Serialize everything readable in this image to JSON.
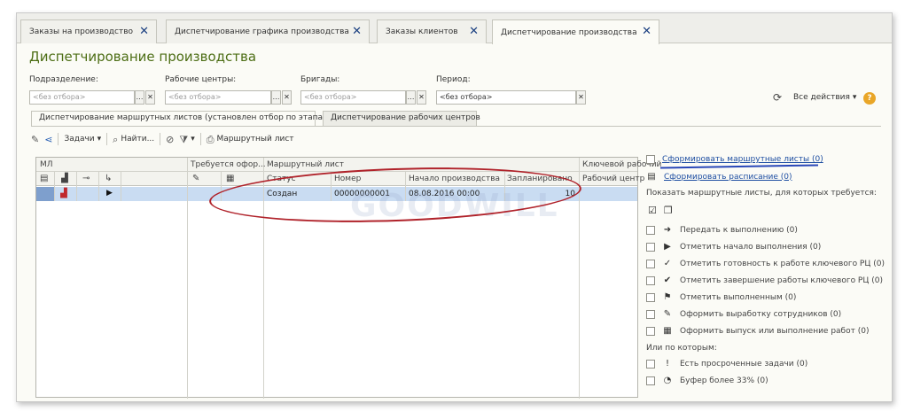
{
  "tabs": [
    {
      "label": "Заказы на производство"
    },
    {
      "label": "Диспетчирование графика производства"
    },
    {
      "label": "Заказы клиентов"
    },
    {
      "label": "Диспетчирование производства"
    }
  ],
  "page_title": "Диспетчирование производства",
  "filters": {
    "division_label": "Подразделение:",
    "division_value": "<без отбора>",
    "workcenters_label": "Рабочие центры:",
    "workcenters_value": "<без отбора>",
    "brigades_label": "Бригады:",
    "brigades_value": "<без отбора>",
    "period_label": "Период:",
    "period_value": "<без отбора>"
  },
  "all_actions": "Все действия",
  "section_tabs": [
    {
      "label": "Диспетчирование маршрутных листов (установлен отбор по этапам)"
    },
    {
      "label": "Диспетчирование рабочих центров"
    }
  ],
  "toolbar": {
    "tasks": "Задачи",
    "find": "Найти...",
    "route_sheet": "Маршрутный лист"
  },
  "grid": {
    "group_ml": "МЛ",
    "group_required": "Требуется офор...",
    "group_route_sheet": "Маршрутный лист",
    "group_key_wc": "Ключевой рабочий",
    "col_status": "Статус",
    "col_number": "Номер",
    "col_start": "Начало производства",
    "col_planned": "Запланировано",
    "col_workcenter": "Рабочий центр",
    "rows": [
      {
        "status": "Создан",
        "number": "00000000001",
        "start": "08.08.2016 00:00",
        "planned": "10",
        "workcenter": ""
      }
    ]
  },
  "right_panel": {
    "link_generate_sheets": "Сформировать маршрутные листы (0)",
    "link_generate_schedule": "Сформировать расписание (0)",
    "show_label": "Показать маршрутные листы, для которых требуется:",
    "items": [
      {
        "icon": "arrow-right-icon",
        "label": "Передать к выполнению (0)"
      },
      {
        "icon": "play-icon",
        "label": "Отметить начало выполнения (0)"
      },
      {
        "icon": "check-outline-icon",
        "label": "Отметить готовность к работе ключевого РЦ (0)"
      },
      {
        "icon": "check-icon",
        "label": "Отметить завершение работы ключевого РЦ (0)"
      },
      {
        "icon": "finish-flag-icon",
        "label": "Отметить выполненным (0)"
      },
      {
        "icon": "wrench-icon",
        "label": "Оформить выработку сотрудников (0)"
      },
      {
        "icon": "grid-icon",
        "label": "Оформить выпуск или выполнение работ (0)"
      }
    ],
    "or_label": "Или по которым:",
    "extra_items": [
      {
        "icon": "exclamation-icon",
        "label": "Есть просроченные задачи (0)"
      },
      {
        "icon": "pie-icon",
        "label": "Буфер более 33% (0)"
      }
    ]
  },
  "watermark": "GOODWILL",
  "colors": {
    "title": "#4d6e15",
    "link": "#1f4fa2",
    "selection": "#c9dcf2",
    "annotation": "#b0222a"
  }
}
